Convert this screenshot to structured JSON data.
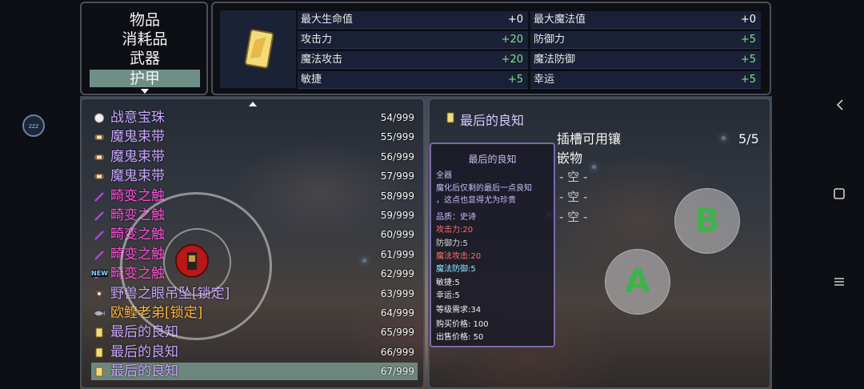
{
  "categories": {
    "items": [
      "物品",
      "消耗品",
      "武器",
      "护甲"
    ],
    "selected_index": 3
  },
  "stats": {
    "left": [
      {
        "name": "最大生命值",
        "value": "+0"
      },
      {
        "name": "攻击力",
        "value": "+20"
      },
      {
        "name": "魔法攻击",
        "value": "+20"
      },
      {
        "name": "敏捷",
        "value": "+5"
      }
    ],
    "right": [
      {
        "name": "最大魔法值",
        "value": "+0"
      },
      {
        "name": "防御力",
        "value": "+5"
      },
      {
        "name": "魔法防御",
        "value": "+5"
      },
      {
        "name": "幸运",
        "value": "+5"
      }
    ]
  },
  "inventory": {
    "rows": [
      {
        "icon": "pearl-icon",
        "name": "战意宝珠",
        "count": "54/999",
        "color": "#c9a6ff"
      },
      {
        "icon": "belt-icon",
        "name": "魔鬼束带",
        "count": "55/999",
        "color": "#c9a6ff"
      },
      {
        "icon": "belt-icon",
        "name": "魔鬼束带",
        "count": "56/999",
        "color": "#c9a6ff"
      },
      {
        "icon": "belt-icon",
        "name": "魔鬼束带",
        "count": "57/999",
        "color": "#c9a6ff"
      },
      {
        "icon": "tentacle-icon",
        "name": "畸变之触",
        "count": "58/999",
        "color": "#ff4fd8"
      },
      {
        "icon": "tentacle-icon",
        "name": "畸变之触",
        "count": "59/999",
        "color": "#ff4fd8"
      },
      {
        "icon": "tentacle-icon",
        "name": "畸变之触",
        "count": "60/999",
        "color": "#ff4fd8"
      },
      {
        "icon": "tentacle-icon",
        "name": "畸变之触",
        "count": "61/999",
        "color": "#ff4fd8"
      },
      {
        "icon": "tentacle-icon",
        "name": "畸变之触",
        "count": "62/999",
        "color": "#ff4fd8",
        "new_badge": "NEW"
      },
      {
        "icon": "pendant-icon",
        "name": "野兽之眼吊坠[锁定]",
        "count": "63/999",
        "color": "#c9a6ff"
      },
      {
        "icon": "fish-icon",
        "name": "欧鳇老弟[锁定]",
        "count": "64/999",
        "color": "#ffb341"
      },
      {
        "icon": "card-icon",
        "name": "最后的良知",
        "count": "65/999",
        "color": "#c9a6ff"
      },
      {
        "icon": "card-icon",
        "name": "最后的良知",
        "count": "66/999",
        "color": "#c9a6ff"
      },
      {
        "icon": "card-icon",
        "name": "最后的良知",
        "count": "67/999",
        "color": "#c9a6ff"
      }
    ],
    "selected_index": 13
  },
  "detail": {
    "title": "最后的良知",
    "socket_title": "插槽可用镶嵌物",
    "socket_count": "5/5",
    "slots": [
      "- 空 -",
      "- 空 -",
      "- 空 -"
    ]
  },
  "tooltip": {
    "title": "最后的良知",
    "lines": [
      {
        "text": "全器",
        "style": "desc"
      },
      {
        "text": "魔化后仅剩的最后一点良知",
        "style": "desc"
      },
      {
        "text": "，这点也显得尤为珍贵",
        "style": "desc"
      },
      {
        "text": "品质：史诗",
        "style": "desc"
      },
      {
        "text": "攻击力:20",
        "style": "red"
      },
      {
        "text": "防御力:5",
        "style": "gray"
      },
      {
        "text": "魔法攻击:20",
        "style": "red"
      },
      {
        "text": "魔法防御:5",
        "style": "cyan"
      },
      {
        "text": "敏捷:5",
        "style": "white"
      },
      {
        "text": "幸运:5",
        "style": "white"
      },
      {
        "text": "等级需求:34",
        "style": "white"
      },
      {
        "text": "购买价格: 100",
        "style": "white"
      },
      {
        "text": "出售价格: 50",
        "style": "white"
      }
    ]
  },
  "controls": {
    "a_label": "A",
    "b_label": "B",
    "sleep_label": "zzz"
  }
}
